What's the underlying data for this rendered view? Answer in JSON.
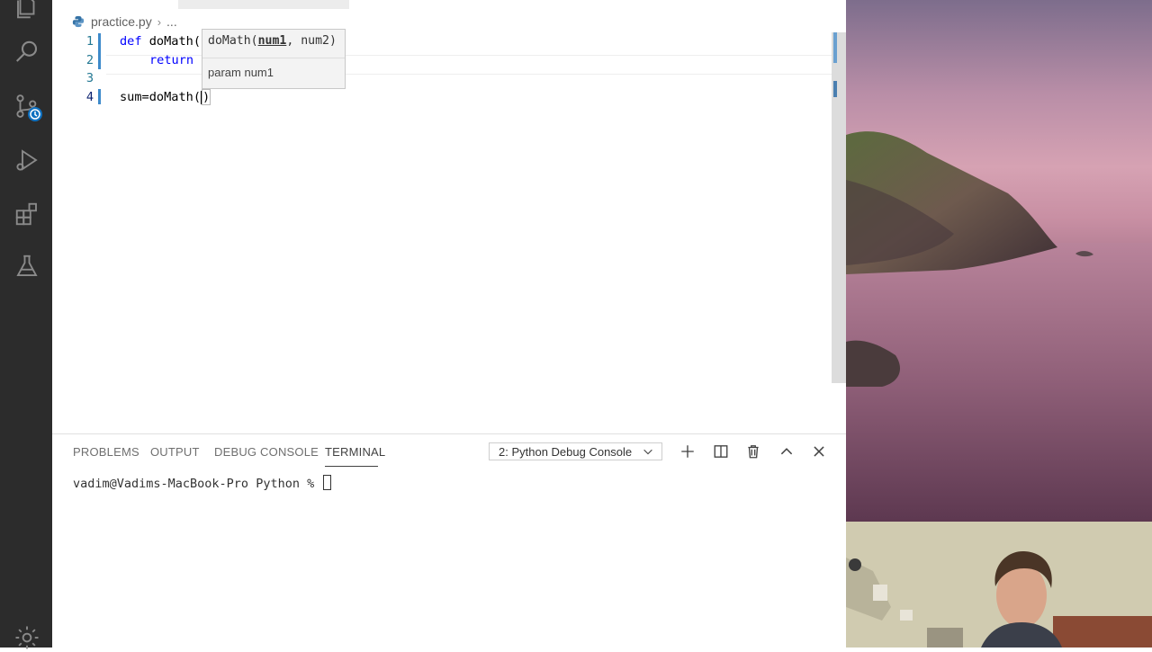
{
  "activity_bar": {
    "items": [
      "explorer-icon",
      "search-icon",
      "source-control-icon",
      "run-debug-icon",
      "extensions-icon",
      "testing-icon",
      "settings-gear-icon"
    ]
  },
  "editor": {
    "breadcrumb": {
      "file": "practice.py",
      "rest": "..."
    },
    "lines": [
      {
        "num": "1",
        "keyword": "def",
        "text": " doMath("
      },
      {
        "num": "2",
        "keyword": "return",
        "text": ""
      },
      {
        "num": "3",
        "text": ""
      },
      {
        "num": "4",
        "text_before": "sum=doMath(",
        "text_after": ")"
      }
    ],
    "signature_help": {
      "prefix": "doMath(",
      "active_param": "num1",
      "rest": ", num2)",
      "doc": "param num1"
    }
  },
  "panel": {
    "tabs": [
      "PROBLEMS",
      "OUTPUT",
      "DEBUG CONSOLE",
      "TERMINAL"
    ],
    "active_tab": "TERMINAL",
    "terminal_select": "2: Python Debug Console",
    "prompt": "vadim@Vadims-MacBook-Pro Python % "
  },
  "colors": {
    "activity_bar": "#2c2c2c",
    "keyword": "#0000ff",
    "line_number": "#237893",
    "indent_guide": "#3e8acb",
    "accent": "#0e70c0"
  }
}
